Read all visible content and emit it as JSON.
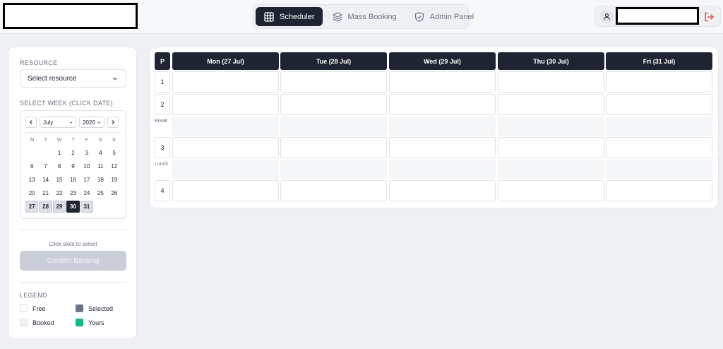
{
  "header": {
    "nav": [
      {
        "label": "Scheduler",
        "icon": "grid-icon",
        "active": true
      },
      {
        "label": "Mass Booking",
        "icon": "layers-icon",
        "active": false
      },
      {
        "label": "Admin Panel",
        "icon": "shield-icon",
        "active": false
      }
    ]
  },
  "sidebar": {
    "resource_label": "RESOURCE",
    "resource_select": "Select resource",
    "week_label": "SELECT WEEK (CLICK DATE)",
    "calendar": {
      "month": "July",
      "year": "2026",
      "dow": [
        "M",
        "T",
        "W",
        "T",
        "F",
        "S",
        "S"
      ],
      "days": [
        "",
        "",
        "1",
        "2",
        "3",
        "4",
        "5",
        "6",
        "7",
        "8",
        "9",
        "10",
        "11",
        "12",
        "13",
        "14",
        "15",
        "16",
        "17",
        "18",
        "19",
        "20",
        "21",
        "22",
        "23",
        "24",
        "25",
        "26",
        "27",
        "28",
        "29",
        "30",
        "31"
      ],
      "selected_week": [
        "27",
        "28",
        "29",
        "30",
        "31"
      ],
      "today": "30"
    },
    "hint": "Click slots to select",
    "confirm_label": "Confirm Booking",
    "legend_label": "LEGEND",
    "legend": [
      {
        "label": "Free",
        "color": "#ffffff"
      },
      {
        "label": "Selected",
        "color": "#6b7489"
      },
      {
        "label": "Booked",
        "color": "#f1f2f5"
      },
      {
        "label": "Yours",
        "color": "#10b981"
      }
    ]
  },
  "timetable": {
    "corner": "P",
    "days": [
      "Mon (27 Jul)",
      "Tue (28 Jul)",
      "Wed (29 Jul)",
      "Thu (30 Jul)",
      "Fri (31 Jul)"
    ],
    "rows": [
      {
        "type": "period",
        "label": "1"
      },
      {
        "type": "period",
        "label": "2"
      },
      {
        "type": "break",
        "label": "Break"
      },
      {
        "type": "period",
        "label": "3"
      },
      {
        "type": "break",
        "label": "Lunch"
      },
      {
        "type": "period",
        "label": "4"
      }
    ]
  }
}
